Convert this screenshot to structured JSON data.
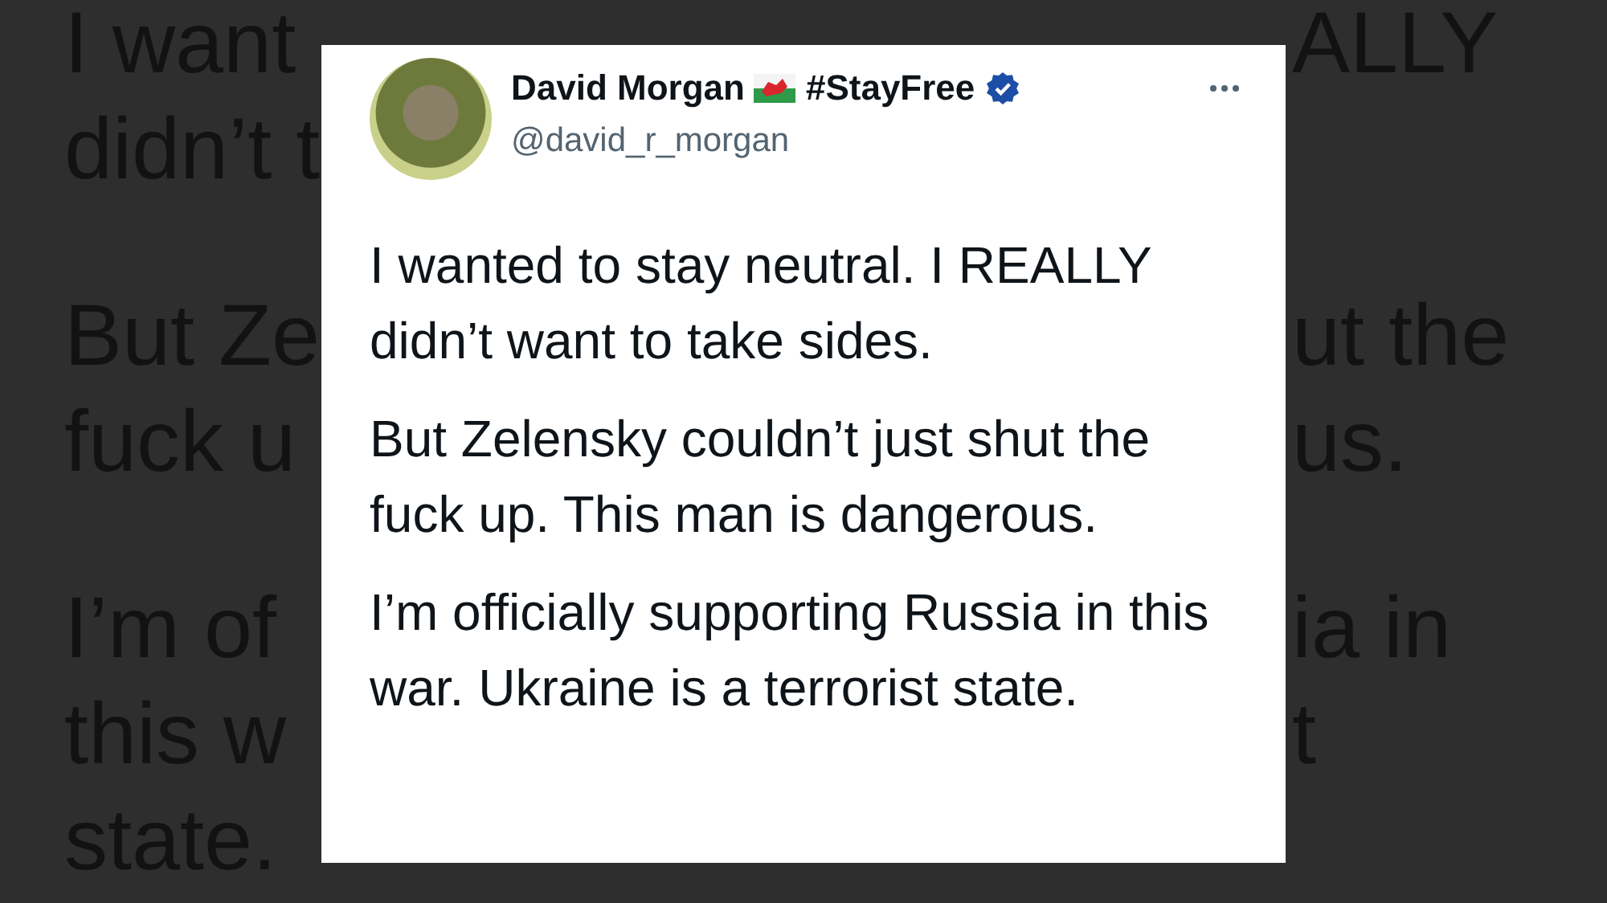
{
  "background_text": [
    {
      "lines": [
        {
          "left": "I want",
          "right": "ALLY"
        },
        {
          "left": "didn’t t"
        }
      ]
    },
    {
      "lines": [
        {
          "left": "But Ze",
          "right": "ut the"
        },
        {
          "left": "fuck u",
          "right": "us."
        }
      ]
    },
    {
      "lines": [
        {
          "left": "I’m of",
          "right": "ia in"
        },
        {
          "left": "this w",
          "right": "t"
        },
        {
          "left": "state."
        }
      ]
    }
  ],
  "post": {
    "author": {
      "name": "David Morgan",
      "hashtag": "#StayFree",
      "handle": "@david_r_morgan",
      "verified": true
    },
    "paragraphs": [
      "I wanted to stay neutral. I REALLY didn’t want to take sides.",
      "But Zelensky couldn’t just shut the fuck up. This man is dangerous.",
      "I’m officially supporting Russia in this war. Ukraine is a terrorist state."
    ]
  }
}
